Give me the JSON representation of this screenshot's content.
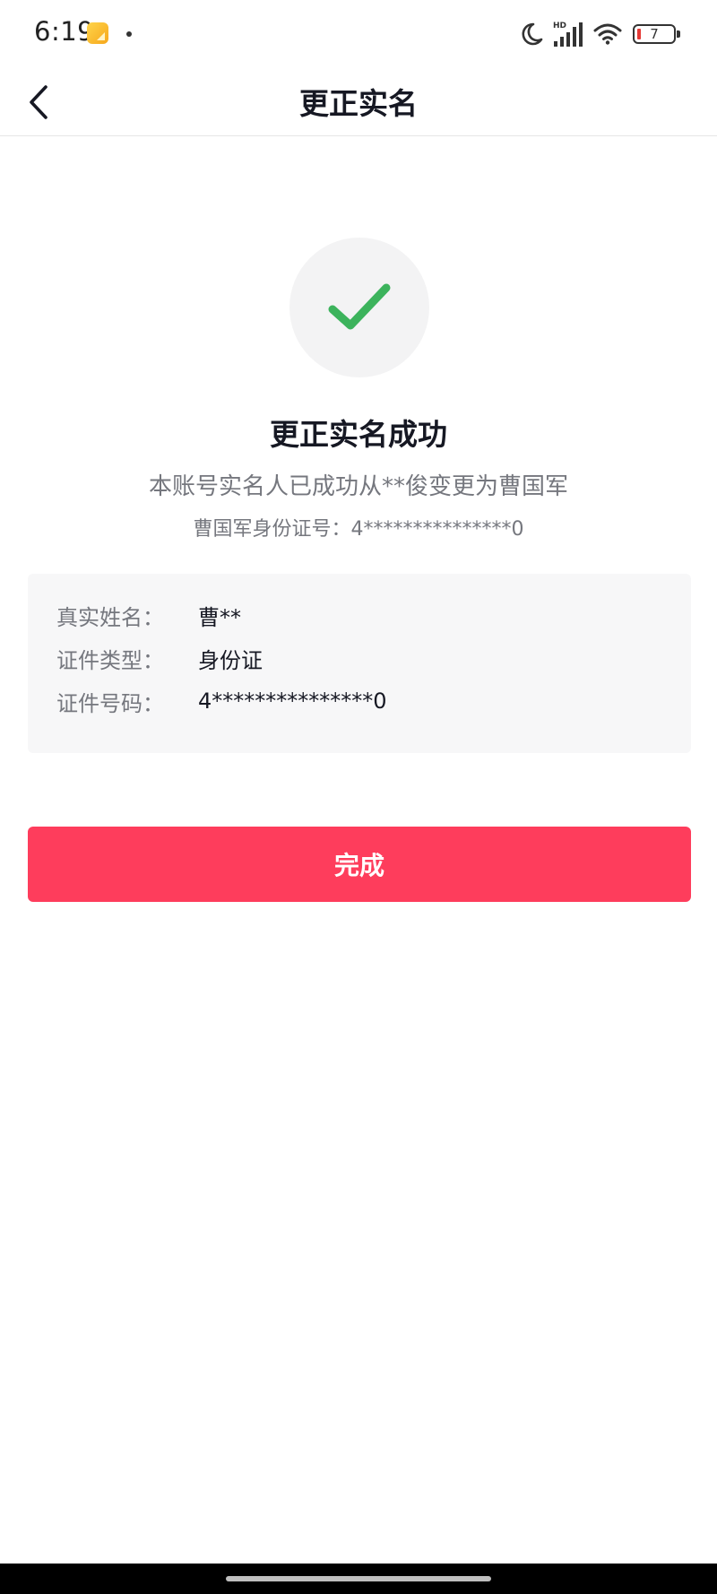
{
  "status_bar": {
    "time": "6:19",
    "signal_badge": "HD",
    "battery_level": "7",
    "icons": [
      "notification-app-icon",
      "dnd-moon-icon",
      "signal-icon",
      "wifi-icon",
      "battery-icon"
    ]
  },
  "nav": {
    "title": "更正实名",
    "back_icon": "chevron-left-icon"
  },
  "result": {
    "icon": "check-icon",
    "title": "更正实名成功",
    "description": "本账号实名人已成功从**俊变更为曹国军",
    "id_line": "曹国军身份证号：4***************0"
  },
  "info": {
    "rows": [
      {
        "label": "真实姓名：",
        "value": "曹**"
      },
      {
        "label": "证件类型：",
        "value": "身份证"
      },
      {
        "label": "证件号码：",
        "value": "4***************0"
      }
    ]
  },
  "actions": {
    "done_label": "完成"
  },
  "colors": {
    "primary": "#fe3d5c",
    "success": "#3cb35c",
    "card_background": "#f7f7f8",
    "muted_text": "#75777e"
  }
}
